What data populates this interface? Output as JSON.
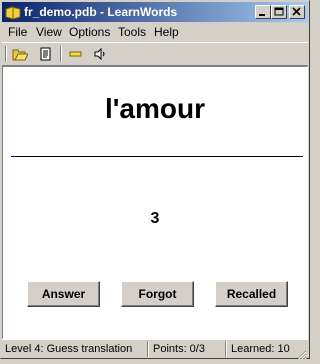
{
  "window": {
    "title": "fr_demo.pdb - LearnWords",
    "accent": "#0a246a",
    "controls": [
      "minimize-icon",
      "maximize-icon",
      "close-icon"
    ]
  },
  "menu": {
    "items": [
      "File",
      "View",
      "Options",
      "Tools",
      "Help"
    ]
  },
  "toolbar": {
    "tools": [
      "open-folder-icon",
      "document-icon",
      "minus-icon",
      "speaker-icon"
    ]
  },
  "card": {
    "word": "l'amour",
    "count": "3"
  },
  "buttons": {
    "answer": "Answer",
    "forgot": "Forgot",
    "recalled": "Recalled"
  },
  "status": {
    "level": "Level 4: Guess translation",
    "points": "Points: 0/3",
    "learned": "Learned: 10"
  }
}
